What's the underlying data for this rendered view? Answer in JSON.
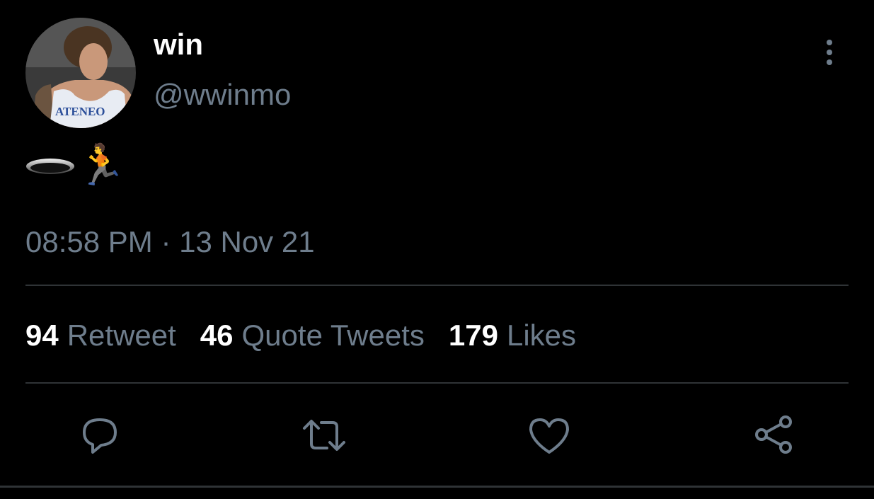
{
  "tweet": {
    "display_name": "win",
    "handle": "@wwinmo",
    "avatar_text": "ATENEO",
    "body_emojis": [
      "disc",
      "🏃"
    ],
    "timestamp": "08:58 PM · 13 Nov 21"
  },
  "stats": {
    "retweets": {
      "count": "94",
      "label": "Retweet"
    },
    "quotes": {
      "count": "46",
      "label": "Quote Tweets"
    },
    "likes": {
      "count": "179",
      "label": "Likes"
    }
  },
  "actions": [
    "reply-icon",
    "retweet-icon",
    "like-icon",
    "share-icon"
  ],
  "colors": {
    "background": "#000000",
    "primary_text": "#ffffff",
    "secondary_text": "#6e7d8c",
    "divider": "#2f3336"
  }
}
